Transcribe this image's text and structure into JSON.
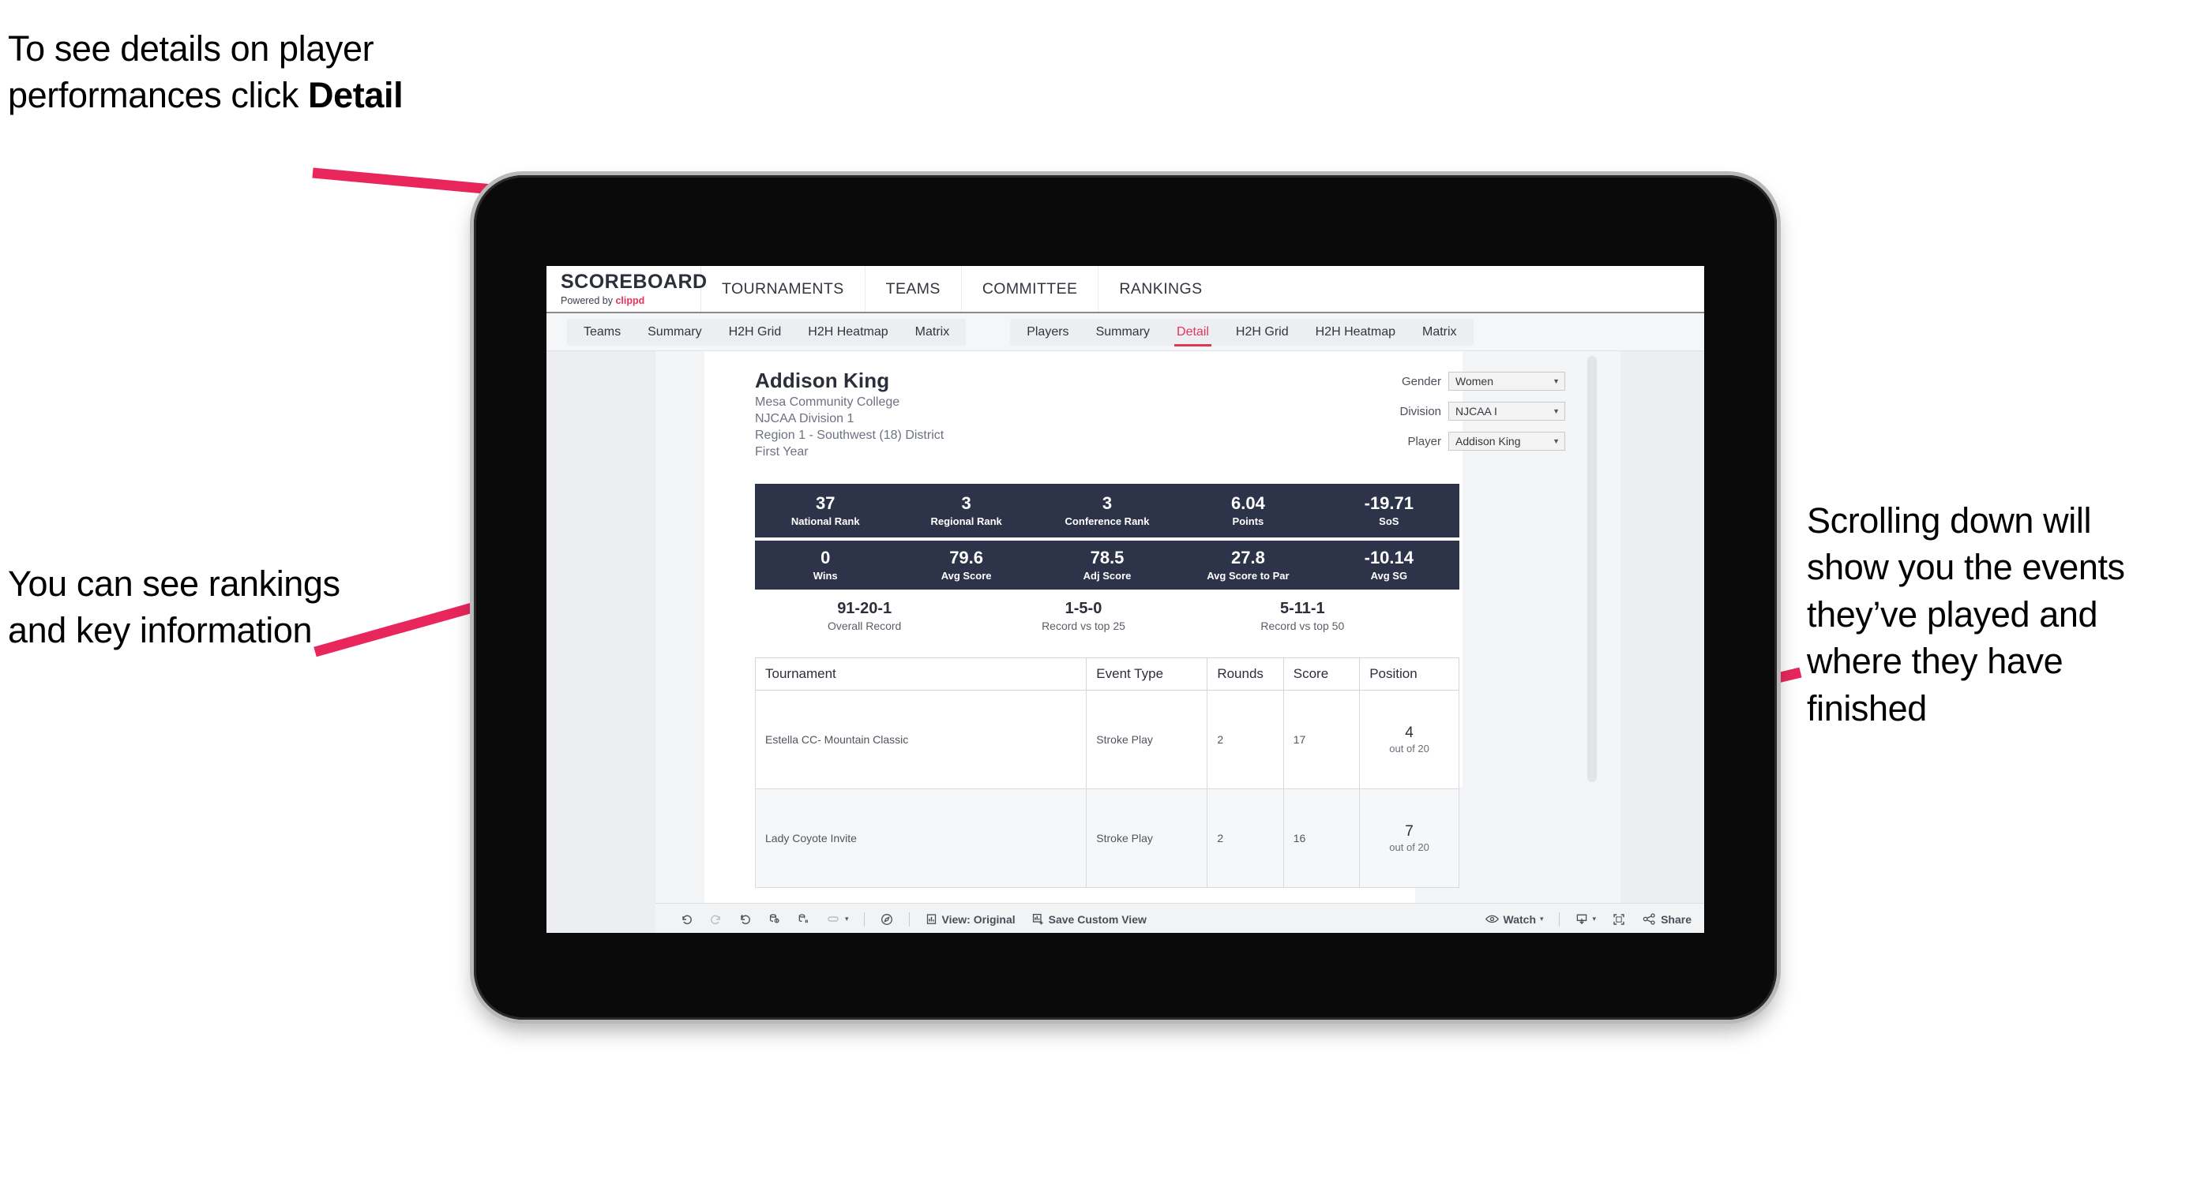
{
  "annotations": {
    "top_left": "To see details on player performances click ",
    "top_left_bold": "Detail",
    "left": "You can see rankings and key information",
    "right": "Scrolling down will show you the events they’ve played and where they have finished",
    "arrow_color": "#e8265c"
  },
  "browser": {
    "brand": {
      "title": "SCOREBOARD",
      "powered_prefix": "Powered by ",
      "powered_brand": "clippd"
    },
    "top_nav": [
      "TOURNAMENTS",
      "TEAMS",
      "COMMITTEE",
      "RANKINGS"
    ],
    "sub_nav_group_1": [
      "Teams",
      "Summary",
      "H2H Grid",
      "H2H Heatmap",
      "Matrix"
    ],
    "sub_nav_group_2": [
      "Players",
      "Summary",
      "Detail",
      "H2H Grid",
      "H2H Heatmap",
      "Matrix"
    ],
    "active_tab": "Detail",
    "active_color": "#e0365a"
  },
  "player": {
    "name": "Addison King",
    "school": "Mesa Community College",
    "division": "NJCAA Division 1",
    "region": "Region 1 - Southwest (18) District",
    "year": "First Year"
  },
  "filters": [
    {
      "label": "Gender",
      "value": "Women"
    },
    {
      "label": "Division",
      "value": "NJCAA I"
    },
    {
      "label": "Player",
      "value": "Addison King"
    }
  ],
  "stats_row_1": [
    {
      "value": "37",
      "label": "National Rank"
    },
    {
      "value": "3",
      "label": "Regional Rank"
    },
    {
      "value": "3",
      "label": "Conference Rank"
    },
    {
      "value": "6.04",
      "label": "Points"
    },
    {
      "value": "-19.71",
      "label": "SoS"
    }
  ],
  "stats_row_2": [
    {
      "value": "0",
      "label": "Wins"
    },
    {
      "value": "79.6",
      "label": "Avg Score"
    },
    {
      "value": "78.5",
      "label": "Adj Score"
    },
    {
      "value": "27.8",
      "label": "Avg Score to Par"
    },
    {
      "value": "-10.14",
      "label": "Avg SG"
    }
  ],
  "records": [
    {
      "value": "91-20-1",
      "label": "Overall Record"
    },
    {
      "value": "1-5-0",
      "label": "Record vs top 25"
    },
    {
      "value": "5-11-1",
      "label": "Record vs top 50"
    }
  ],
  "table": {
    "headers": [
      "Tournament",
      "Event Type",
      "Rounds",
      "Score",
      "Position"
    ],
    "rows": [
      {
        "tournament": "Estella CC- Mountain Classic",
        "event_type": "Stroke Play",
        "rounds": "2",
        "score": "17",
        "position": "4",
        "position_suffix": "out of 20"
      },
      {
        "tournament": "Lady Coyote Invite",
        "event_type": "Stroke Play",
        "rounds": "2",
        "score": "16",
        "position": "7",
        "position_suffix": "out of 20"
      }
    ]
  },
  "toolbar": {
    "view_label": "View: Original",
    "save_label": "Save Custom View",
    "watch_label": "Watch",
    "share_label": "Share",
    "caret": "▾"
  },
  "colors": {
    "band": "#2d3349",
    "accent": "#e0365a",
    "canvas": "#eceef1"
  }
}
